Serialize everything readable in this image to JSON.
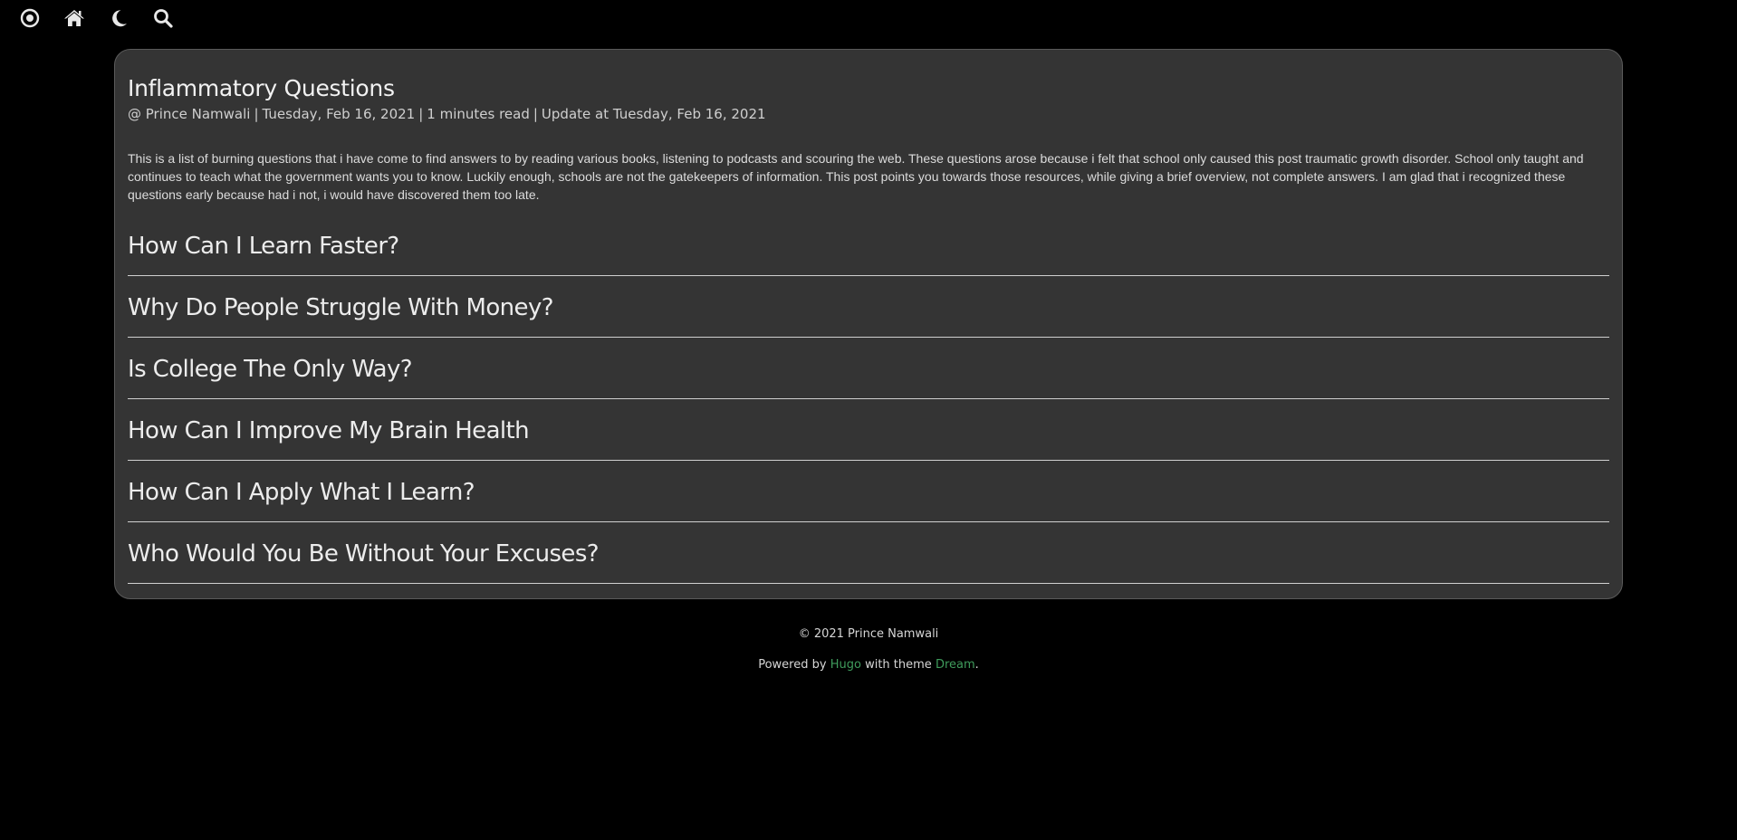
{
  "nav": {
    "icons": [
      "target-icon",
      "home-icon",
      "moon-icon",
      "search-icon"
    ]
  },
  "post": {
    "title": "Inflammatory Questions",
    "author": "@ Prince Namwali",
    "date": "Tuesday, Feb 16, 2021",
    "read_time": "1 minutes read",
    "updated": "Update at Tuesday, Feb 16, 2021",
    "separator": "|",
    "intro": "This is a list of burning questions that i have come to find answers to by reading various books, listening to podcasts and scouring the web. These questions arose because i felt that school only caused this post traumatic growth disorder. School only taught and continues to teach what the government wants you to know. Luckily enough, schools are not the gatekeepers of information. This post points you towards those resources, while giving a brief overview, not complete answers. I am glad that i recognized these questions early because had i not, i would have discovered them too late.",
    "sections": [
      {
        "heading": "How Can I Learn Faster?"
      },
      {
        "heading": "Why Do People Struggle With Money?"
      },
      {
        "heading": "Is College The Only Way?"
      },
      {
        "heading": "How Can I Improve My Brain Health"
      },
      {
        "heading": "How Can I Apply What I Learn?"
      },
      {
        "heading": "Who Would You Be Without Your Excuses?"
      }
    ]
  },
  "footer": {
    "copyright": "© 2021 Prince Namwali",
    "powered_prefix": "Powered by",
    "hugo_label": "Hugo",
    "with_theme": "with theme",
    "theme_label": "Dream",
    "period": "."
  },
  "colors": {
    "background": "#000000",
    "card": "#343434",
    "link": "#3f9c5c"
  }
}
